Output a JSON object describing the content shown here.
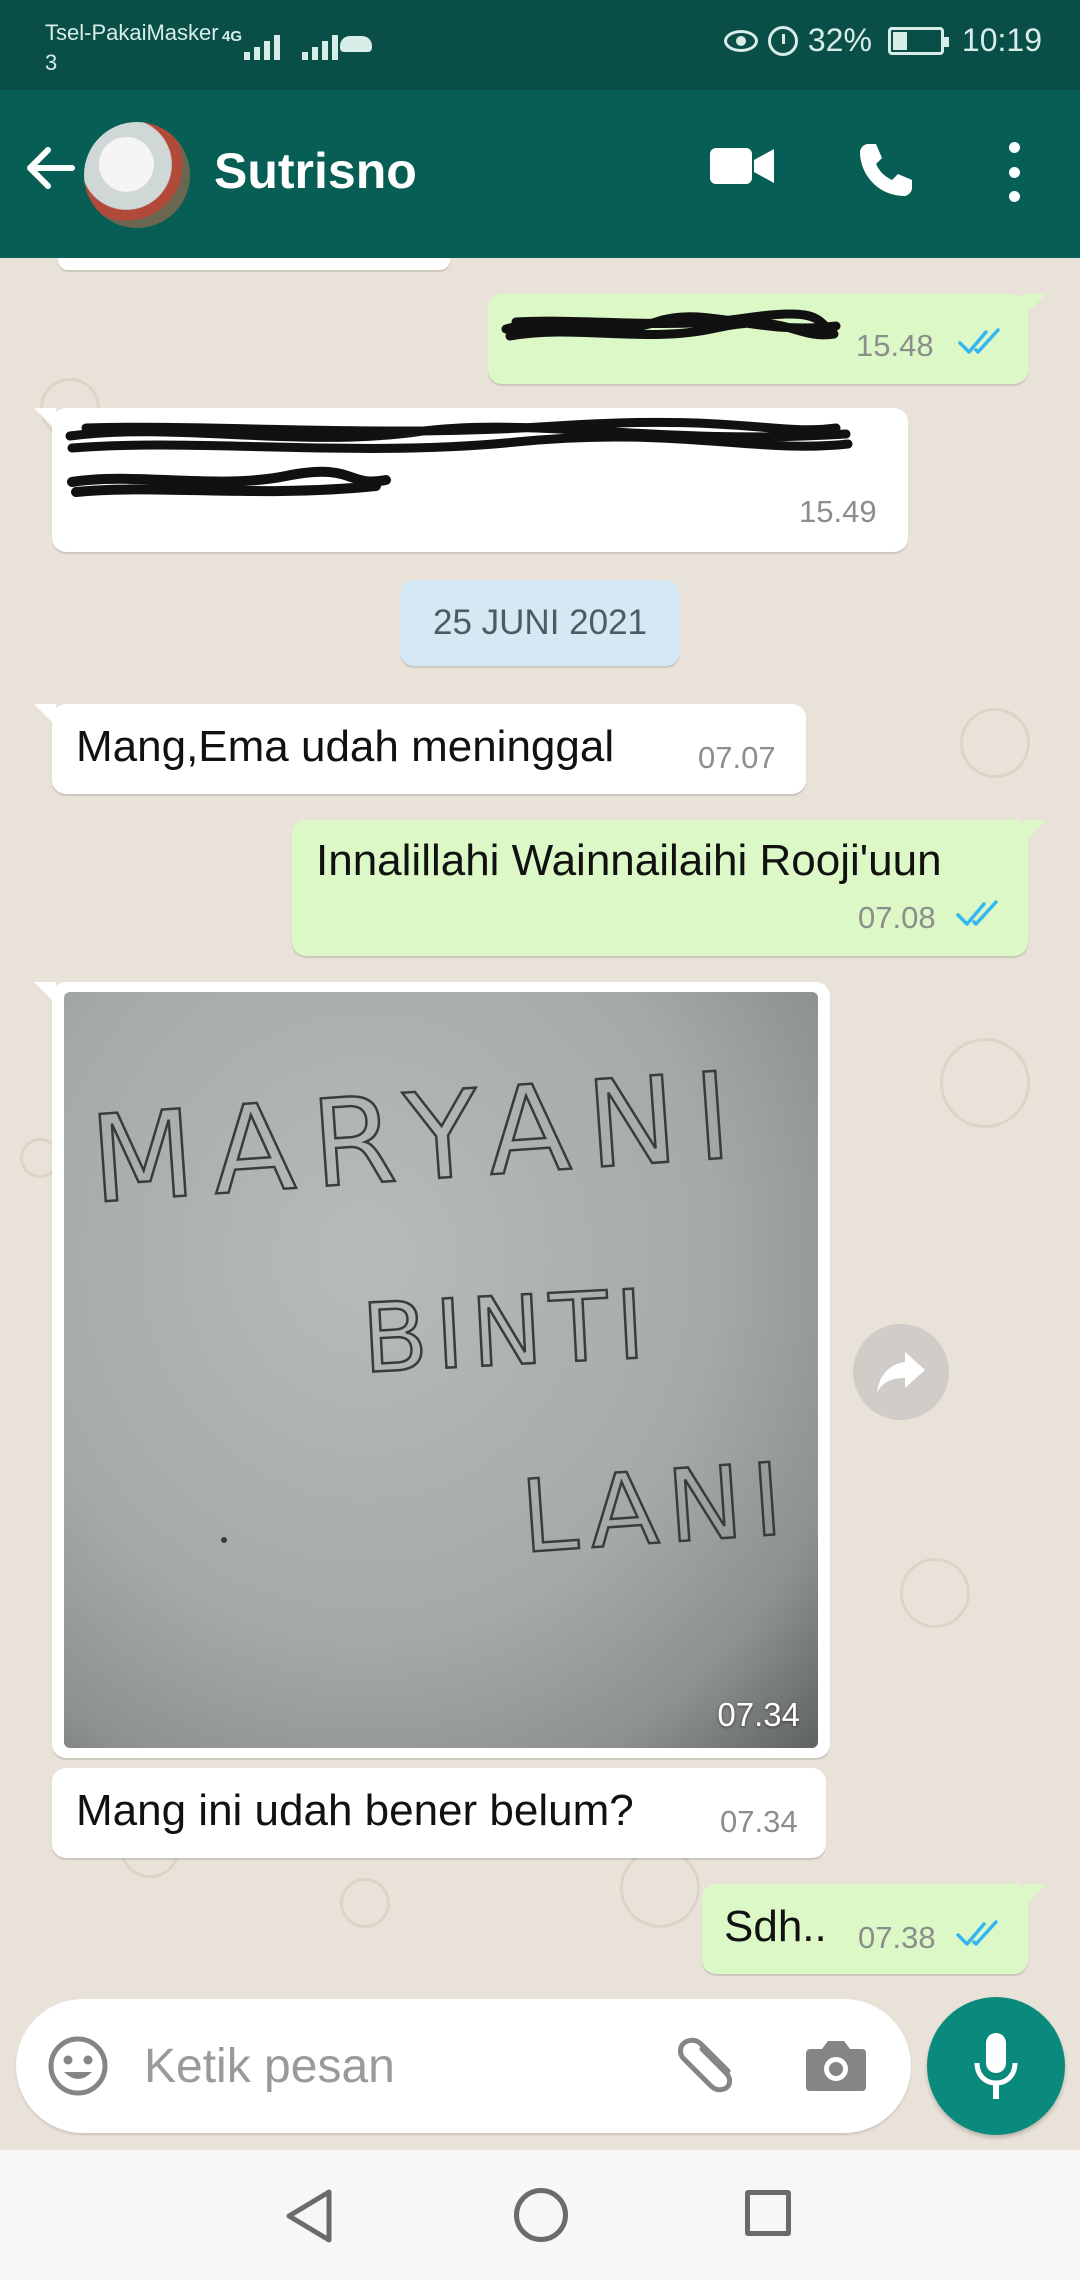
{
  "status_bar": {
    "carrier": "Tsel-PakaiMasker 3",
    "network": "4G",
    "battery": "32%",
    "time": "10:19"
  },
  "header": {
    "contact_name": "Sutrisno"
  },
  "messages": [
    {
      "direction": "out",
      "time": "15.48"
    },
    {
      "direction": "in",
      "time": "15.49"
    },
    {
      "date_chip": "25 JUNI 2021"
    },
    {
      "direction": "in",
      "text": "Mang,Ema udah meninggal",
      "time": "07.07"
    },
    {
      "direction": "out",
      "text": "Innalillahi Wainnailaihi Rooji'uun",
      "time": "07.08"
    },
    {
      "direction": "in",
      "type": "image",
      "time": "07.34",
      "handwriting": [
        "MARYANI",
        "BINTI",
        "LANI"
      ]
    },
    {
      "direction": "in",
      "text": "Mang ini udah bener belum?",
      "time": "07.34"
    },
    {
      "direction": "out",
      "text": "Sdh..",
      "time": "07.38"
    }
  ],
  "composer": {
    "placeholder": "Ketik pesan"
  },
  "colors": {
    "header": "#075e54",
    "status_bar": "#0a4f47",
    "outgoing_bubble": "#dcf8c6",
    "incoming_bubble": "#ffffff",
    "read_ticks": "#34b7f1",
    "mic_button": "#0a8a7c"
  },
  "icons": [
    "back-arrow-icon",
    "video-call-icon",
    "phone-icon",
    "more-vert-icon",
    "read-ticks-icon",
    "forward-icon",
    "emoji-icon",
    "attach-icon",
    "camera-icon",
    "mic-icon"
  ]
}
